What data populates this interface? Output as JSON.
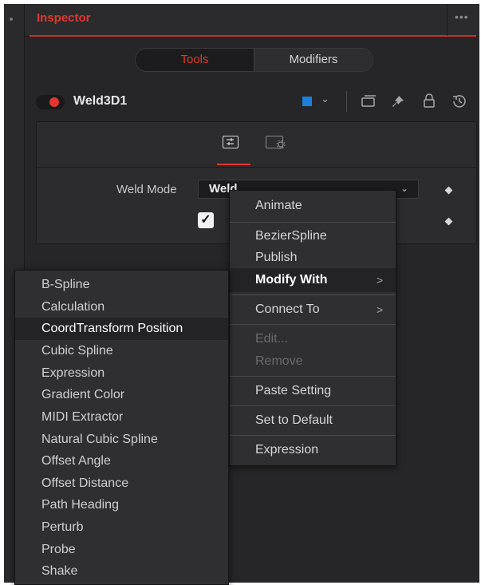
{
  "header": {
    "title": "Inspector",
    "more_label": "•••"
  },
  "tabs": [
    {
      "label": "Tools",
      "active": true
    },
    {
      "label": "Modifiers",
      "active": false
    }
  ],
  "node": {
    "name": "Weld3D1",
    "enabled": true,
    "color": "#1e7fd8"
  },
  "toolbar_icons": [
    "version-icon",
    "pin-icon",
    "lock-icon",
    "reset-icon"
  ],
  "controls": {
    "weld_mode_label": "Weld Mode",
    "weld_mode_value": "Weld",
    "checkbox_checked": true,
    "checkmark": "✓"
  },
  "context_menu": {
    "items": [
      {
        "label": "Animate",
        "enabled": true
      },
      {
        "label": "BezierSpline",
        "enabled": true
      },
      {
        "label": "Publish",
        "enabled": true
      },
      {
        "label": "Modify With",
        "enabled": true,
        "submenu": true,
        "highlighted": true
      },
      {
        "label": "Connect To",
        "enabled": true,
        "submenu": true
      },
      {
        "label": "Edit...",
        "enabled": false
      },
      {
        "label": "Remove",
        "enabled": false
      },
      {
        "label": "Paste Setting",
        "enabled": true
      },
      {
        "label": "Set to Default",
        "enabled": true
      },
      {
        "label": "Expression",
        "enabled": true
      }
    ]
  },
  "submenu": {
    "items": [
      "B-Spline",
      "Calculation",
      "CoordTransform Position",
      "Cubic Spline",
      "Expression",
      "Gradient Color",
      "MIDI Extractor",
      "Natural Cubic Spline",
      "Offset Angle",
      "Offset Distance",
      "Path Heading",
      "Perturb",
      "Probe",
      "Shake"
    ],
    "highlighted": "CoordTransform Position"
  },
  "arrow_glyph": ">"
}
